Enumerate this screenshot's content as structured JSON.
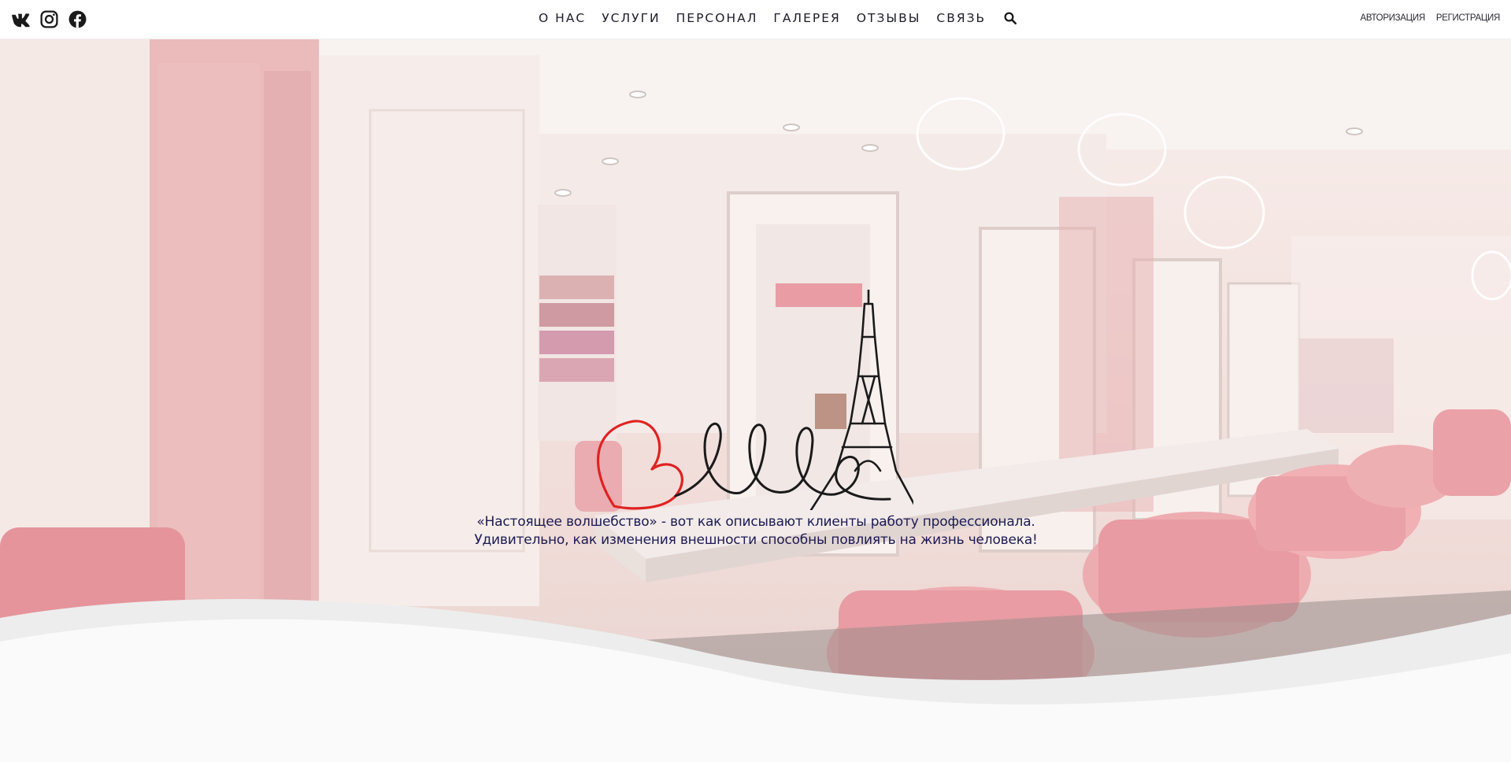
{
  "social": {
    "icons": [
      "vk-icon",
      "instagram-icon",
      "facebook-icon"
    ]
  },
  "nav": {
    "items": [
      {
        "label": "О НАС"
      },
      {
        "label": "УСЛУГИ"
      },
      {
        "label": "ПЕРСОНАЛ"
      },
      {
        "label": "ГАЛЕРЕЯ"
      },
      {
        "label": "ОТЗЫВЫ"
      },
      {
        "label": "СВЯЗЬ"
      }
    ],
    "search_icon": "search-icon"
  },
  "auth": {
    "login_label": "АВТОРИЗАЦИЯ",
    "register_label": "РЕГИСТРАЦИЯ"
  },
  "hero": {
    "logo_text": "Belle",
    "tagline_line1": "«Настоящее волшебство» - вот как описывают клиенты работу профессионала.",
    "tagline_line2": "Удивительно, как изменения внешности способны повлиять на жизнь человека!",
    "background": "salon-interior-photo"
  },
  "colors": {
    "accent_red": "#e02222",
    "logo_dark": "#1a1a1a",
    "tagline": "#1c1a52",
    "pink": "#e8a3a6"
  }
}
